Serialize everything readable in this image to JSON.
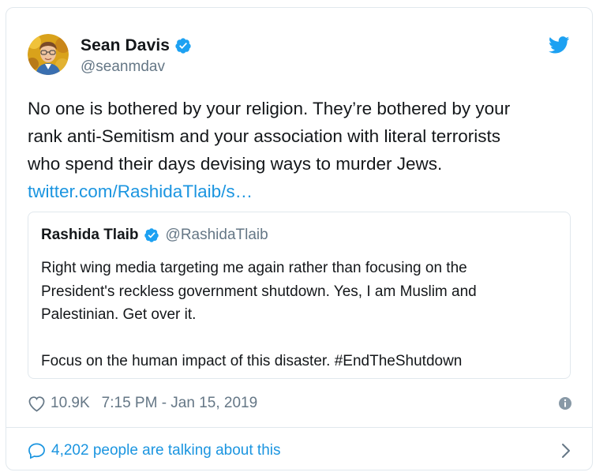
{
  "author": {
    "name": "Sean Davis",
    "handle": "@seanmdav",
    "verified": true
  },
  "tweet": {
    "lines": [
      "No one is bothered by your religion. They’re bothered by your",
      "rank anti-Semitism and your association with literal terrorists",
      "who spend their days devising ways to murder Jews."
    ],
    "link_text": "twitter.com/RashidaTlaib/s…"
  },
  "quoted_tweet": {
    "name": "Rashida Tlaib",
    "handle": "@RashidaTlaib",
    "verified": true,
    "lines": [
      "Right wing media targeting me again rather than focusing on the",
      "President's reckless government shutdown. Yes, I am Muslim and",
      "Palestinian. Get over it.",
      "",
      "Focus on the human impact of this disaster. #EndTheShutdown"
    ]
  },
  "meta": {
    "like_count": "10.9K",
    "timestamp": "7:15 PM - Jan 15, 2019"
  },
  "footer": {
    "talking_text": "4,202 people are talking about this"
  },
  "colors": {
    "link": "#1b95e0",
    "muted": "#657786",
    "text": "#14171a",
    "border": "#e1e8ed",
    "verified": "#1da1f2"
  },
  "icons": {
    "verified": "verified-badge-icon",
    "brand": "twitter-bird-icon",
    "like": "heart-icon",
    "info": "info-icon",
    "reply": "speech-bubble-icon",
    "more": "chevron-right-icon"
  }
}
